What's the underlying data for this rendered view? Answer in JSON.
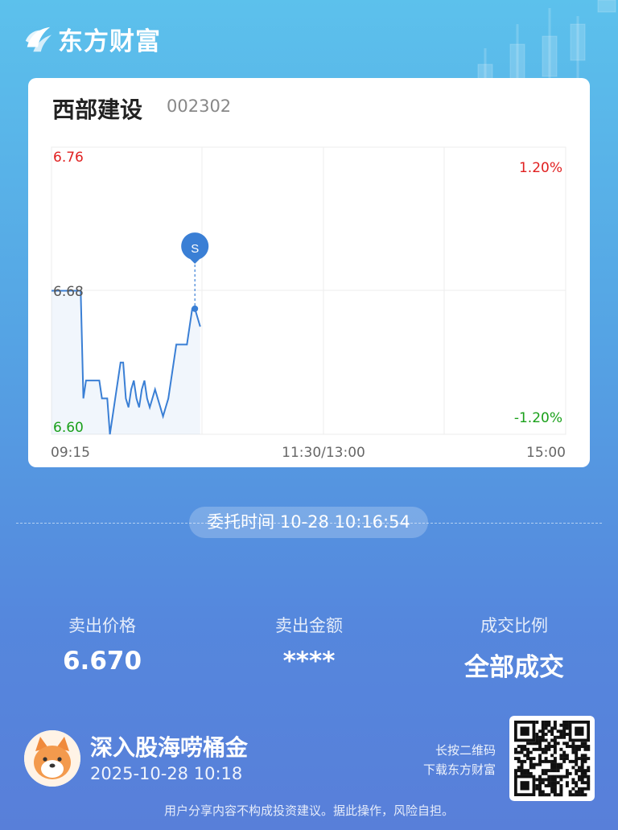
{
  "brand": {
    "name": "东方财富",
    "logo_icon": "eastmoney-logo-icon"
  },
  "stock": {
    "name": "西部建设",
    "code": "002302"
  },
  "chart_data": {
    "type": "line",
    "price_labels": {
      "high": "6.76",
      "mid": "6.68",
      "low": "6.60"
    },
    "pct_labels": {
      "high": "1.20%",
      "low": "-1.20%"
    },
    "time_labels": [
      "09:15",
      "11:30/13:00",
      "15:00"
    ],
    "ylim": [
      6.6,
      6.76
    ],
    "prev_close": 6.68,
    "series": [
      {
        "values": [
          6.68,
          6.68,
          6.68,
          6.68,
          6.68,
          6.68,
          6.68,
          6.68,
          6.68,
          6.68,
          6.68,
          6.68,
          6.62,
          6.63,
          6.63,
          6.63,
          6.63,
          6.63,
          6.63,
          6.62,
          6.62,
          6.62,
          6.6,
          6.61,
          6.62,
          6.63,
          6.64,
          6.64,
          6.62,
          6.615,
          6.625,
          6.63,
          6.62,
          6.615,
          6.625,
          6.63,
          6.62,
          6.615,
          6.62,
          6.625,
          6.62,
          6.615,
          6.61,
          6.615,
          6.62,
          6.63,
          6.64,
          6.65,
          6.65,
          6.65,
          6.65,
          6.65,
          6.66,
          6.67,
          6.67,
          6.665,
          6.66
        ],
        "color": "#3a7fd5"
      }
    ],
    "marker": {
      "label": "S",
      "value": 6.67,
      "color": "#3a7fd5"
    },
    "up_color": "#e02020",
    "down_color": "#1aa01a"
  },
  "order": {
    "time_label": "委托时间",
    "time_value": "10-28 10:16:54"
  },
  "stats": [
    {
      "label": "卖出价格",
      "value": "6.670"
    },
    {
      "label": "卖出金额",
      "value": "****"
    },
    {
      "label": "成交比例",
      "value": "全部成交"
    }
  ],
  "user": {
    "title": "深入股海唠桶金",
    "time": "2025-10-28 10:18",
    "avatar_icon": "shiba-dog-avatar-icon"
  },
  "qr": {
    "hint_line1": "长按二维码",
    "hint_line2": "下载东方财富",
    "icon": "qr-code-icon"
  },
  "disclaimer": "用户分享内容不构成投资建议。据此操作，风险自担。"
}
